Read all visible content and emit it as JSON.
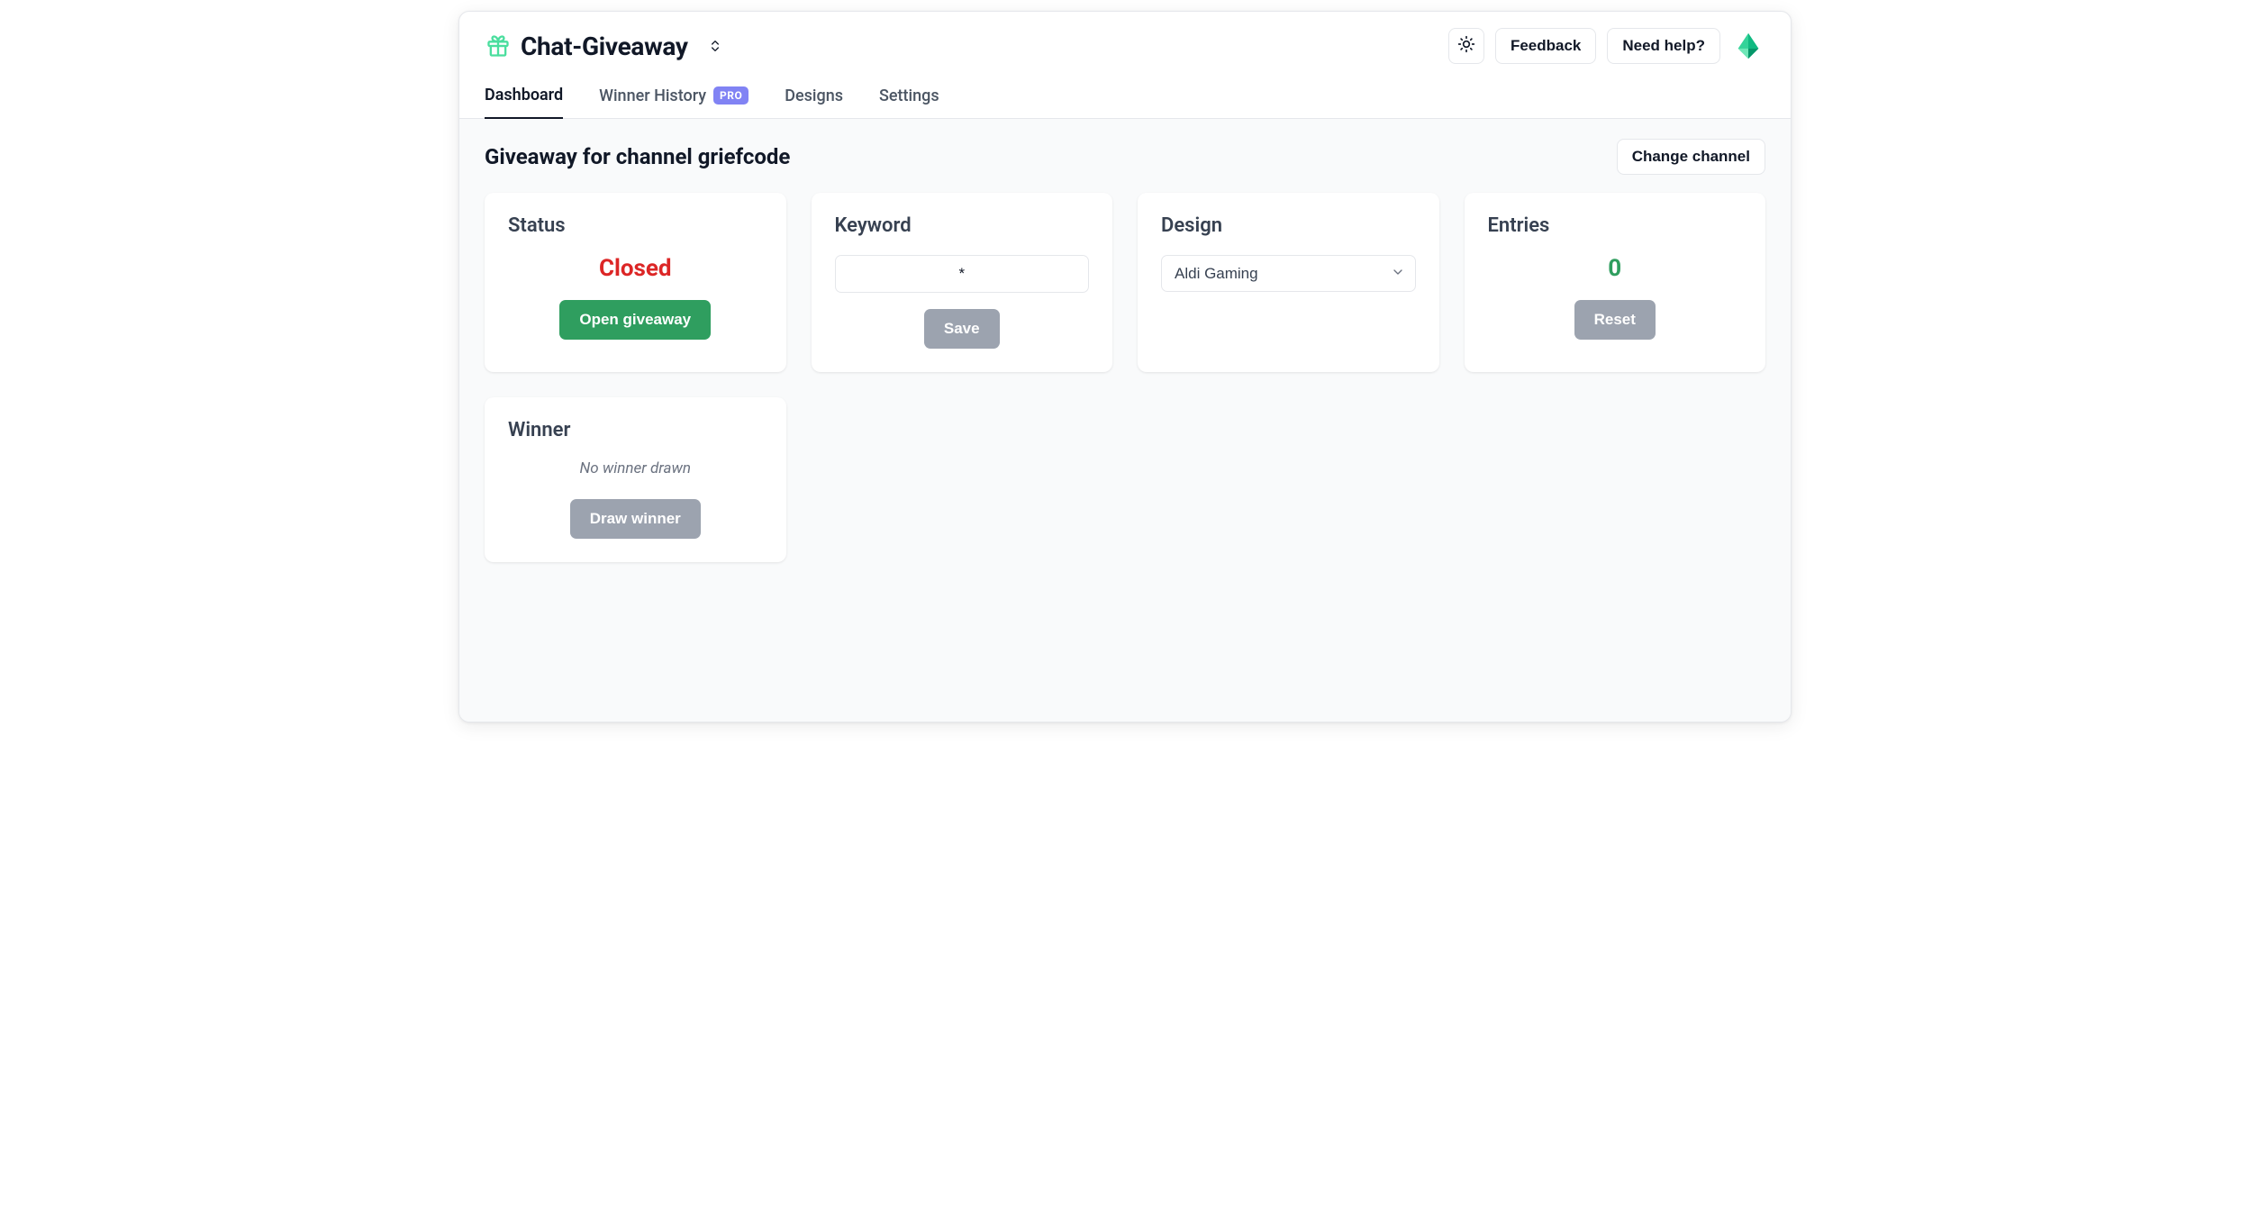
{
  "app": {
    "title": "Chat-Giveaway"
  },
  "header": {
    "feedback_label": "Feedback",
    "help_label": "Need help?"
  },
  "tabs": {
    "dashboard": "Dashboard",
    "winner_history": "Winner History",
    "winner_history_badge": "PRO",
    "designs": "Designs",
    "settings": "Settings"
  },
  "page": {
    "title": "Giveaway for channel griefcode",
    "change_channel_label": "Change channel"
  },
  "status": {
    "title": "Status",
    "value": "Closed",
    "open_button": "Open giveaway"
  },
  "keyword": {
    "title": "Keyword",
    "value": "*",
    "save_button": "Save"
  },
  "design": {
    "title": "Design",
    "selected": "Aldi Gaming"
  },
  "entries": {
    "title": "Entries",
    "count": "0",
    "reset_button": "Reset"
  },
  "winner": {
    "title": "Winner",
    "empty_text": "No winner drawn",
    "draw_button": "Draw winner"
  }
}
